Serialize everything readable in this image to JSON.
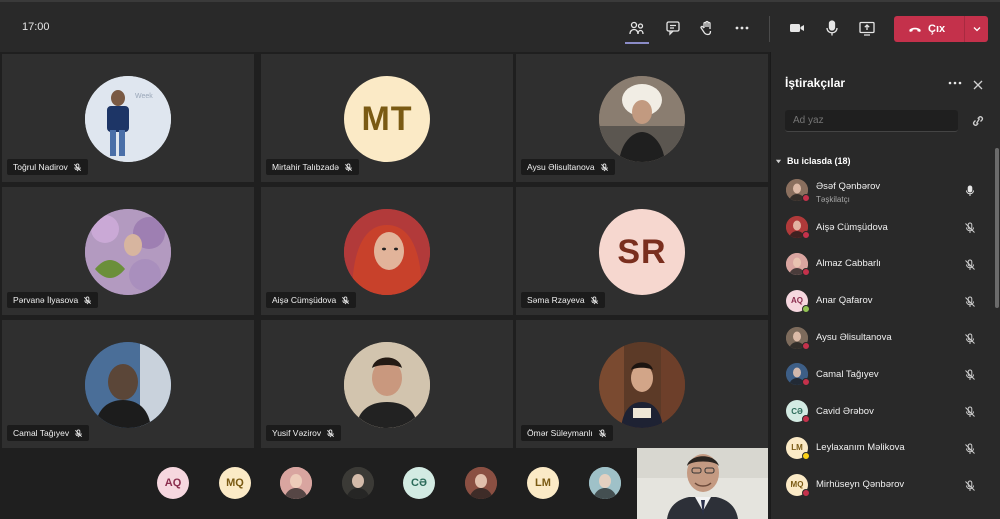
{
  "topbar": {
    "time": "17:00",
    "leave_label": "Çıx",
    "icons": [
      "people-icon",
      "chat-icon",
      "raise-hand-icon",
      "more-icon",
      "camera-icon",
      "mic-icon",
      "share-screen-icon"
    ]
  },
  "grid": {
    "tiles": [
      {
        "name": "Toğrul Nadirov",
        "avatar": "photo",
        "bg": "#dfe6ef"
      },
      {
        "name": "Mirtahir Talıbzadə",
        "avatar": "initials",
        "initials": "MT",
        "bg": "#fbeac6",
        "fg": "#7a5a13"
      },
      {
        "name": "Aysu Əlisultanova",
        "avatar": "photo",
        "bg": "#7d6b5c"
      },
      {
        "name": "Pərvanə İlyasova",
        "avatar": "photo",
        "bg": "#9b7fb0"
      },
      {
        "name": "Aişə Cümşüdova",
        "avatar": "photo",
        "bg": "#b03a3a"
      },
      {
        "name": "Səma Rzayeva",
        "avatar": "initials",
        "initials": "SR",
        "bg": "#f6d7cf",
        "fg": "#7a2e1e"
      },
      {
        "name": "Camal Tağıyev",
        "avatar": "photo",
        "bg": "#3d5e86"
      },
      {
        "name": "Yusif Vəzirov",
        "avatar": "photo",
        "bg": "#c9b9a3"
      },
      {
        "name": "Ömər Süleymanlı",
        "avatar": "photo",
        "bg": "#5b3a2a"
      }
    ]
  },
  "strip": {
    "items": [
      {
        "label": "AQ",
        "bg": "#f6d7df",
        "fg": "#8a2c4d"
      },
      {
        "label": "MQ",
        "bg": "#fbeac6",
        "fg": "#7a5a13"
      },
      {
        "label": "",
        "bg": "#d9a5a0"
      },
      {
        "label": "",
        "bg": "#3b3a36"
      },
      {
        "label": "CƏ",
        "bg": "#d3ebe3",
        "fg": "#2c6b5a"
      },
      {
        "label": "",
        "bg": "#8a4f42"
      },
      {
        "label": "LM",
        "bg": "#fbeac6",
        "fg": "#7a5a13"
      },
      {
        "label": "",
        "bg": "#9fc1c8"
      }
    ]
  },
  "panel": {
    "title": "İştirakçılar",
    "search_placeholder": "Ad yaz",
    "section_label": "Bu iclasda (18)",
    "participants": [
      {
        "name": "Əsəf Qənbərov",
        "role": "Təşkilatçı",
        "avatar": "photo",
        "bg": "#8a6f5e",
        "status": "#c4314b",
        "mic": "on"
      },
      {
        "name": "Aişə Cümşüdova",
        "avatar": "photo",
        "bg": "#b03a3a",
        "status": "#c4314b",
        "mic": "off"
      },
      {
        "name": "Almaz Cabbarlı",
        "avatar": "photo",
        "bg": "#d9a5a0",
        "status": "#c4314b",
        "mic": "off"
      },
      {
        "name": "Anar Qafarov",
        "avatar": "initials",
        "initials": "AQ",
        "bg": "#f6d7df",
        "fg": "#8a2c4d",
        "status": "#92c353",
        "mic": "off"
      },
      {
        "name": "Aysu Əlisultanova",
        "avatar": "photo",
        "bg": "#7d6b5c",
        "status": "#c4314b",
        "mic": "off"
      },
      {
        "name": "Camal Tağıyev",
        "avatar": "photo",
        "bg": "#3d5e86",
        "status": "#c4314b",
        "mic": "off"
      },
      {
        "name": "Cavid Ərəbov",
        "avatar": "initials",
        "initials": "CƏ",
        "bg": "#d3ebe3",
        "fg": "#2c6b5a",
        "status": "#c4314b",
        "mic": "off"
      },
      {
        "name": "Leylaxanım Məlikova",
        "avatar": "initials",
        "initials": "LM",
        "bg": "#fbeac6",
        "fg": "#7a5a13",
        "status": "#fcd116",
        "mic": "off"
      },
      {
        "name": "Mirhüseyn Qənbərov",
        "avatar": "initials",
        "initials": "MQ",
        "bg": "#fbeac6",
        "fg": "#7a5a13",
        "status": "#c4314b",
        "mic": "off"
      }
    ]
  },
  "colors": {
    "accent": "#8b8cc7",
    "leave": "#c4314b",
    "tile_bg": "#2f2f2f",
    "panel_bg": "#292929"
  }
}
